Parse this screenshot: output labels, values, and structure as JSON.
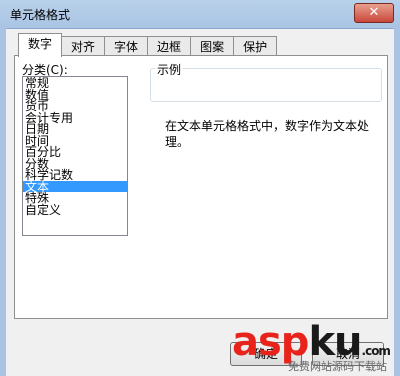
{
  "window": {
    "title": "单元格格式",
    "close_glyph": "✕"
  },
  "tabs": [
    {
      "label": "数字"
    },
    {
      "label": "对齐"
    },
    {
      "label": "字体"
    },
    {
      "label": "边框"
    },
    {
      "label": "图案"
    },
    {
      "label": "保护"
    }
  ],
  "category": {
    "label": "分类(C):",
    "items": [
      "常规",
      "数值",
      "货币",
      "会计专用",
      "日期",
      "时间",
      "百分比",
      "分数",
      "科学记数",
      "文本",
      "特殊",
      "自定义"
    ],
    "selected": "文本"
  },
  "sample": {
    "label": "示例"
  },
  "description": "在文本单元格格式中，数字作为文本处理。",
  "buttons": {
    "ok": "确定",
    "cancel": "取消"
  },
  "watermark": {
    "brand_parts": [
      "asp",
      "ku",
      ".com"
    ],
    "subtext": "免费网站源码下载站",
    "color_a": "#e8231b",
    "color_b": "#1a1a1a"
  }
}
